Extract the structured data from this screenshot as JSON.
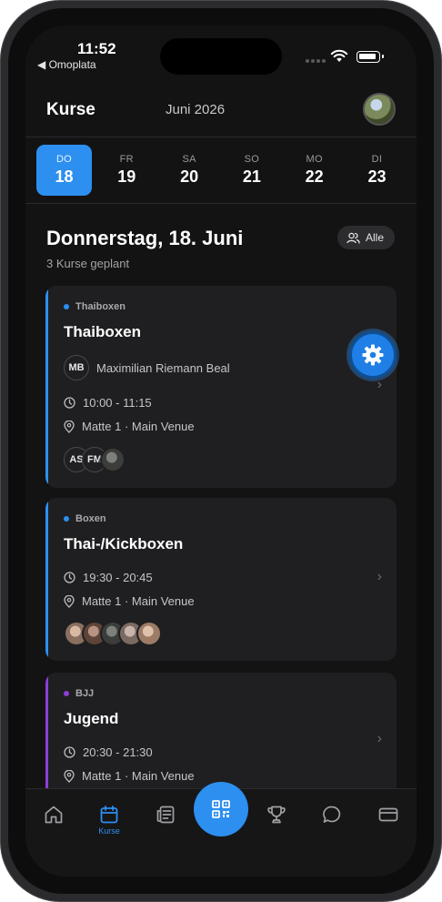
{
  "status_bar": {
    "time": "11:52",
    "back_app": "◀ Omoplata"
  },
  "header": {
    "title": "Kurse",
    "month": "Juni 2026"
  },
  "days": [
    {
      "name": "DO",
      "date": "18",
      "active": true
    },
    {
      "name": "FR",
      "date": "19",
      "active": false
    },
    {
      "name": "SA",
      "date": "20",
      "active": false
    },
    {
      "name": "SO",
      "date": "21",
      "active": false
    },
    {
      "name": "MO",
      "date": "22",
      "active": false
    },
    {
      "name": "DI",
      "date": "23",
      "active": false
    }
  ],
  "section": {
    "heading": "Donnerstag, 18. Juni",
    "subtitle": "3 Kurse geplant",
    "filter_label": "Alle"
  },
  "courses": [
    {
      "category": "Thaiboxen",
      "color": "#2d8ff0",
      "title": "Thaiboxen",
      "trainer_initials": "MB",
      "trainer": "Maximilian Riemann Beal",
      "time": "10:00 - 11:15",
      "location": "Matte 1 · Main Venue",
      "participants": [
        "AS",
        "FM"
      ]
    },
    {
      "category": "Boxen",
      "color": "#2d8ff0",
      "title": "Thai-/Kickboxen",
      "time": "19:30 - 20:45",
      "location": "Matte 1 · Main Venue"
    },
    {
      "category": "BJJ",
      "color": "#8b3fd9",
      "title": "Jugend",
      "time": "20:30 - 21:30",
      "location": "Matte 1 · Main Venue"
    }
  ],
  "tabbar": {
    "active_label": "Kurse"
  },
  "icons": [
    "home-icon",
    "calendar-icon",
    "news-icon",
    "qr-code-icon",
    "trophy-icon",
    "chat-icon",
    "card-icon",
    "gear-icon",
    "clock-icon",
    "location-pin-icon",
    "users-icon",
    "chevron-right-icon"
  ]
}
